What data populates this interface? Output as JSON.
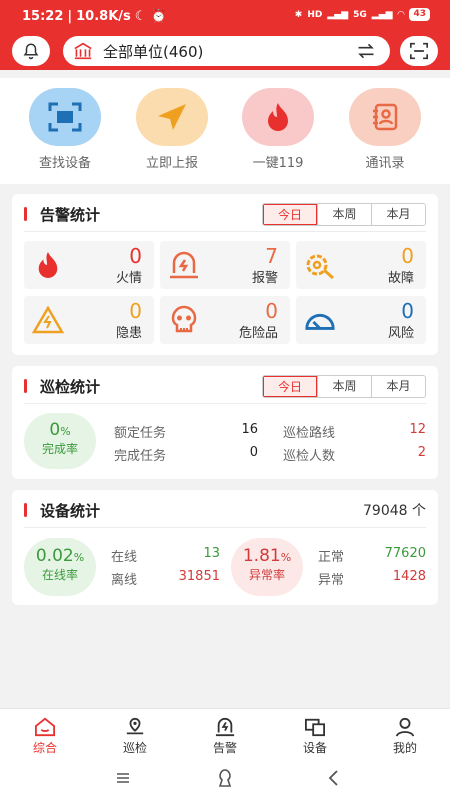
{
  "status": {
    "time": "15:22",
    "speed": "10.8K/s",
    "battery": "43",
    "net1": "HD",
    "net2": "5G"
  },
  "header": {
    "unit_label": "全部单位(460)"
  },
  "quick_actions": [
    {
      "label": "查找设备"
    },
    {
      "label": "立即上报"
    },
    {
      "label": "一键119"
    },
    {
      "label": "通讯录"
    }
  ],
  "alarm": {
    "title": "告警统计",
    "tabs": [
      "今日",
      "本周",
      "本月"
    ],
    "items": [
      {
        "value": "0",
        "name": "火情"
      },
      {
        "value": "7",
        "name": "报警"
      },
      {
        "value": "0",
        "name": "故障"
      },
      {
        "value": "0",
        "name": "隐患"
      },
      {
        "value": "0",
        "name": "危险品"
      },
      {
        "value": "0",
        "name": "风险"
      }
    ]
  },
  "patrol": {
    "title": "巡检统计",
    "tabs": [
      "今日",
      "本周",
      "本月"
    ],
    "rate_value": "0",
    "rate_unit": "%",
    "rate_label": "完成率",
    "rows": [
      {
        "label": "额定任务",
        "value": "16"
      },
      {
        "label": "完成任务",
        "value": "0"
      },
      {
        "label": "巡检路线",
        "value": "12"
      },
      {
        "label": "巡检人数",
        "value": "2"
      }
    ]
  },
  "device": {
    "title": "设备统计",
    "total": "79048 个",
    "online_rate": "0.02",
    "online_unit": "%",
    "online_label": "在线率",
    "online_label_key": "在线",
    "online_value": "13",
    "offline_label": "离线",
    "offline_value": "31851",
    "abnormal_rate": "1.81",
    "abnormal_unit": "%",
    "abnormal_label": "异常率",
    "normal_label": "正常",
    "normal_value": "77620",
    "abn_label": "异常",
    "abn_value": "1428"
  },
  "nav": [
    {
      "label": "综合"
    },
    {
      "label": "巡检"
    },
    {
      "label": "告警"
    },
    {
      "label": "设备"
    },
    {
      "label": "我的"
    }
  ],
  "colors": {
    "brand": "#e8312f",
    "green": "#3a9a3a",
    "blue": "#1f6fb5",
    "orange": "#f0a020"
  }
}
